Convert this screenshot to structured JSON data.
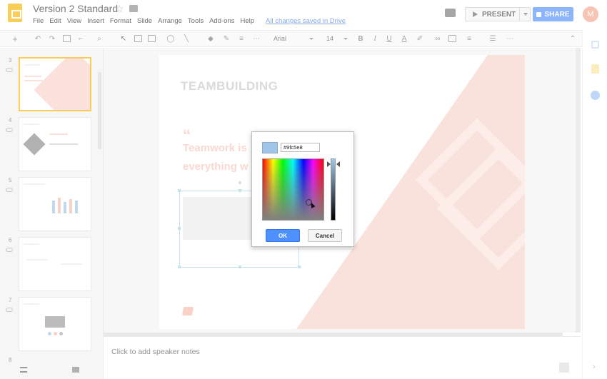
{
  "doc": {
    "title": "Version 2 Standard",
    "save_status": "All changes saved in Drive"
  },
  "menu": [
    "File",
    "Edit",
    "View",
    "Insert",
    "Format",
    "Slide",
    "Arrange",
    "Tools",
    "Add-ons",
    "Help"
  ],
  "header": {
    "present_label": "PRESENT",
    "share_label": "SHARE",
    "avatar_initial": "M"
  },
  "toolbar": {
    "font": "Arial",
    "size": "14",
    "bold": "B",
    "italic": "I",
    "underline": "U",
    "text_color": "A"
  },
  "filmstrip": {
    "slide_numbers": [
      "3",
      "4",
      "5",
      "6",
      "7",
      "8"
    ]
  },
  "slide": {
    "title": "TEAMBUILDING",
    "quote_mark": "“",
    "quote_line1": "Teamwork is",
    "quote_line2": "everything w"
  },
  "notes": {
    "placeholder": "Click to add speaker notes"
  },
  "color_picker": {
    "hex_value": "#9fc5e8",
    "ok_label": "OK",
    "cancel_label": "Cancel"
  },
  "colors": {
    "selected": "#9fc5e8",
    "accent_blue": "#4d90fe",
    "doc_icon": "#f4b400",
    "slide_accent": "#f4b8aa"
  },
  "icons": {
    "header": [
      "slides-doc-icon",
      "star-icon",
      "folder-icon",
      "comments-icon",
      "play-icon",
      "lock-icon"
    ],
    "side_panel": [
      "keep-icon",
      "notes-icon",
      "tasks-icon",
      "expand-icon"
    ]
  }
}
